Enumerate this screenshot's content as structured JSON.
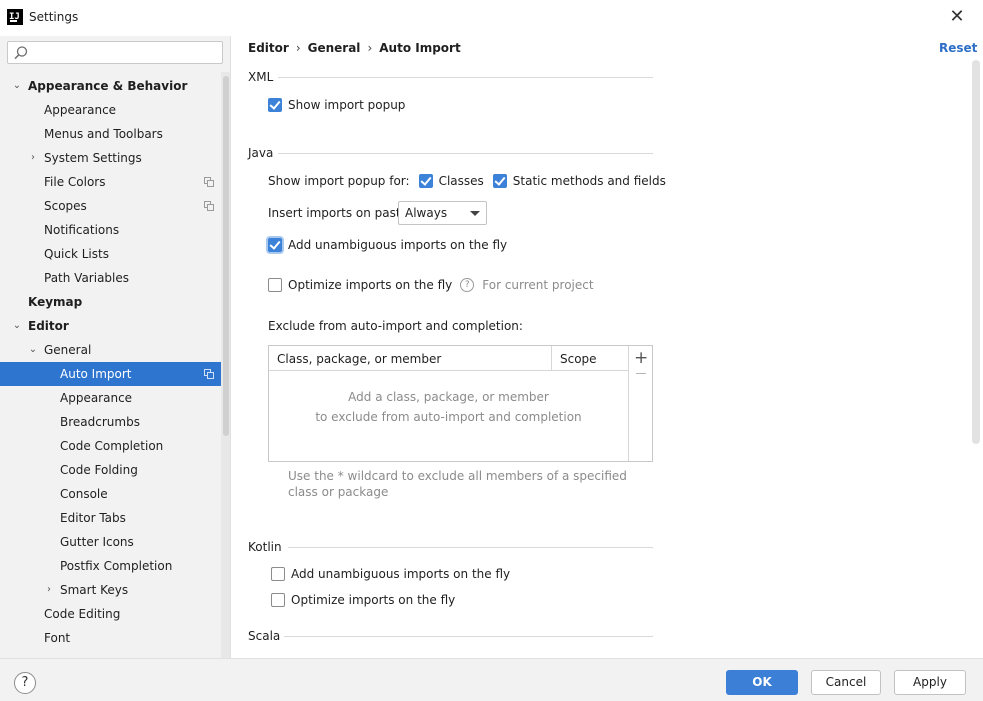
{
  "window": {
    "title": "Settings",
    "app_icon": "IJ",
    "close_glyph": "✕"
  },
  "sidebar": {
    "search_placeholder": "",
    "items": [
      {
        "label": "Appearance & Behavior",
        "level": 0,
        "arrow": "⌄",
        "bold": true
      },
      {
        "label": "Appearance",
        "level": 1
      },
      {
        "label": "Menus and Toolbars",
        "level": 1
      },
      {
        "label": "System Settings",
        "level": 1,
        "arrow": "›"
      },
      {
        "label": "File Colors",
        "level": 1,
        "copy": true
      },
      {
        "label": "Scopes",
        "level": 1,
        "copy": true
      },
      {
        "label": "Notifications",
        "level": 1
      },
      {
        "label": "Quick Lists",
        "level": 1
      },
      {
        "label": "Path Variables",
        "level": 1
      },
      {
        "label": "Keymap",
        "level": 0,
        "bold": true
      },
      {
        "label": "Editor",
        "level": 0,
        "arrow": "⌄",
        "bold": true
      },
      {
        "label": "General",
        "level": 1,
        "arrow": "⌄"
      },
      {
        "label": "Auto Import",
        "level": 2,
        "copy": true,
        "selected": true
      },
      {
        "label": "Appearance",
        "level": 2
      },
      {
        "label": "Breadcrumbs",
        "level": 2
      },
      {
        "label": "Code Completion",
        "level": 2
      },
      {
        "label": "Code Folding",
        "level": 2
      },
      {
        "label": "Console",
        "level": 2
      },
      {
        "label": "Editor Tabs",
        "level": 2
      },
      {
        "label": "Gutter Icons",
        "level": 2
      },
      {
        "label": "Postfix Completion",
        "level": 2
      },
      {
        "label": "Smart Keys",
        "level": 2,
        "arrow": "›"
      },
      {
        "label": "Code Editing",
        "level": 1
      },
      {
        "label": "Font",
        "level": 1
      }
    ]
  },
  "breadcrumb": {
    "part1": "Editor",
    "part2": "General",
    "part3": "Auto Import",
    "sep": "›"
  },
  "reset_label": "Reset",
  "xml": {
    "title": "XML",
    "show_import_popup": {
      "label": "Show import popup",
      "checked": true
    }
  },
  "java": {
    "title": "Java",
    "popup_for_label": "Show import popup for:",
    "classes": {
      "label": "Classes",
      "checked": true
    },
    "static_methods": {
      "label": "Static methods and fields",
      "checked": true
    },
    "insert_on_paste_label": "Insert imports on paste:",
    "insert_on_paste_value": "Always",
    "add_unambiguous": {
      "label": "Add unambiguous imports on the fly",
      "checked": true
    },
    "optimize": {
      "label": "Optimize imports on the fly",
      "checked": false
    },
    "help_glyph": "?",
    "for_current_project": "For current project",
    "exclude_label": "Exclude from auto-import and completion:",
    "table": {
      "col1": "Class, package, or member",
      "col2": "Scope",
      "plus": "+",
      "empty_line1": "Add a class, package, or member",
      "empty_line2": "to exclude from auto-import and completion"
    },
    "hint": "Use the * wildcard to exclude all members of a specified class or package"
  },
  "kotlin": {
    "title": "Kotlin",
    "add_unambiguous": {
      "label": "Add unambiguous imports on the fly",
      "checked": false
    },
    "optimize": {
      "label": "Optimize imports on the fly",
      "checked": false
    }
  },
  "scala": {
    "title": "Scala"
  },
  "footer": {
    "help_glyph": "?",
    "ok": "OK",
    "cancel": "Cancel",
    "apply": "Apply"
  },
  "colors": {
    "accent": "#3b82d8",
    "selection": "#2e75d0",
    "link": "#2e6fc7"
  }
}
